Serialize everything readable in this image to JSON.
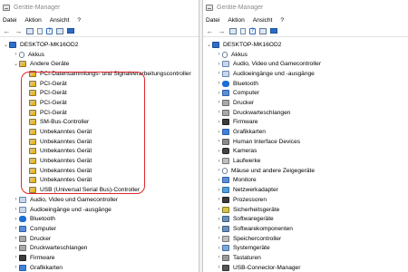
{
  "left": {
    "title": "Geräte-Manager",
    "menu": [
      "Datei",
      "Aktion",
      "Ansicht",
      "?"
    ],
    "root": "DESKTOP-MK16OD2",
    "items": [
      {
        "label": "Akkus",
        "icon": "battery-icon",
        "expand": "›",
        "level": 1
      },
      {
        "label": "Andere Geräte",
        "icon": "warning-device-icon",
        "expand": "⌄",
        "level": 1
      },
      {
        "label": "PCI-Datensammlungs- und Signalverarbeitungscontroller",
        "icon": "unknown-device-icon",
        "level": 2
      },
      {
        "label": "PCI-Gerät",
        "icon": "unknown-device-icon",
        "level": 2
      },
      {
        "label": "PCI-Gerät",
        "icon": "unknown-device-icon",
        "level": 2
      },
      {
        "label": "PCI-Gerät",
        "icon": "unknown-device-icon",
        "level": 2
      },
      {
        "label": "PCI-Gerät",
        "icon": "unknown-device-icon",
        "level": 2
      },
      {
        "label": "SM-Bus-Controller",
        "icon": "unknown-device-icon",
        "level": 2
      },
      {
        "label": "Unbekanntes Gerät",
        "icon": "unknown-device-icon",
        "level": 2
      },
      {
        "label": "Unbekanntes Gerät",
        "icon": "unknown-device-icon",
        "level": 2
      },
      {
        "label": "Unbekanntes Gerät",
        "icon": "unknown-device-icon",
        "level": 2
      },
      {
        "label": "Unbekanntes Gerät",
        "icon": "unknown-device-icon",
        "level": 2
      },
      {
        "label": "Unbekanntes Gerät",
        "icon": "unknown-device-icon",
        "level": 2
      },
      {
        "label": "Unbekanntes Gerät",
        "icon": "unknown-device-icon",
        "level": 2
      },
      {
        "label": "USB (Universal Serial Bus)-Controller",
        "icon": "unknown-device-icon",
        "level": 2
      },
      {
        "label": "Audio, Video und Gamecontroller",
        "icon": "audio-icon",
        "expand": "›",
        "level": 1
      },
      {
        "label": "Audioeingänge und -ausgänge",
        "icon": "audio-icon",
        "expand": "›",
        "level": 1
      },
      {
        "label": "Bluetooth",
        "icon": "bluetooth-icon",
        "expand": "›",
        "level": 1
      },
      {
        "label": "Computer",
        "icon": "computer-icon",
        "expand": "›",
        "level": 1
      },
      {
        "label": "Drucker",
        "icon": "printer-icon",
        "expand": "›",
        "level": 1
      },
      {
        "label": "Druckwarteschlangen",
        "icon": "printer-icon",
        "expand": "›",
        "level": 1
      },
      {
        "label": "Firmware",
        "icon": "firmware-icon",
        "expand": "›",
        "level": 1
      },
      {
        "label": "Grafikkarten",
        "icon": "gpu-icon",
        "expand": "›",
        "level": 1
      }
    ]
  },
  "right": {
    "title": "Geräte-Manager",
    "menu": [
      "Datei",
      "Aktion",
      "Ansicht",
      "?"
    ],
    "root": "DESKTOP-MK16OD2",
    "items": [
      {
        "label": "Akkus",
        "icon": "battery-icon"
      },
      {
        "label": "Audio, Video und Gamecontroller",
        "icon": "audio-icon"
      },
      {
        "label": "Audioeingänge und -ausgänge",
        "icon": "audio-icon"
      },
      {
        "label": "Bluetooth",
        "icon": "bluetooth-icon"
      },
      {
        "label": "Computer",
        "icon": "computer-icon"
      },
      {
        "label": "Drucker",
        "icon": "printer-icon"
      },
      {
        "label": "Druckwarteschlangen",
        "icon": "printer-icon"
      },
      {
        "label": "Firmware",
        "icon": "firmware-icon"
      },
      {
        "label": "Grafikkarten",
        "icon": "gpu-icon"
      },
      {
        "label": "Human Interface Devices",
        "icon": "hid-icon"
      },
      {
        "label": "Kameras",
        "icon": "camera-icon"
      },
      {
        "label": "Laufwerke",
        "icon": "disk-icon"
      },
      {
        "label": "Mäuse und andere Zeigegeräte",
        "icon": "mouse-icon"
      },
      {
        "label": "Monitore",
        "icon": "monitor-icon"
      },
      {
        "label": "Netzwerkadapter",
        "icon": "network-icon"
      },
      {
        "label": "Prozessoren",
        "icon": "processor-icon"
      },
      {
        "label": "Sicherheitsgeräte",
        "icon": "security-icon"
      },
      {
        "label": "Softwaregeräte",
        "icon": "software-icon"
      },
      {
        "label": "Softwarekomponenten",
        "icon": "software-icon"
      },
      {
        "label": "Speichercontroller",
        "icon": "storage-icon"
      },
      {
        "label": "Systemgeräte",
        "icon": "system-icon"
      },
      {
        "label": "Tastaturen",
        "icon": "keyboard-icon"
      },
      {
        "label": "USB-Connector-Manager",
        "icon": "usb-icon"
      }
    ]
  },
  "expand_glyph": "›",
  "collapse_glyph": "⌄",
  "colors": {
    "highlight": "#e0262c",
    "accent": "#2e6bc6"
  }
}
